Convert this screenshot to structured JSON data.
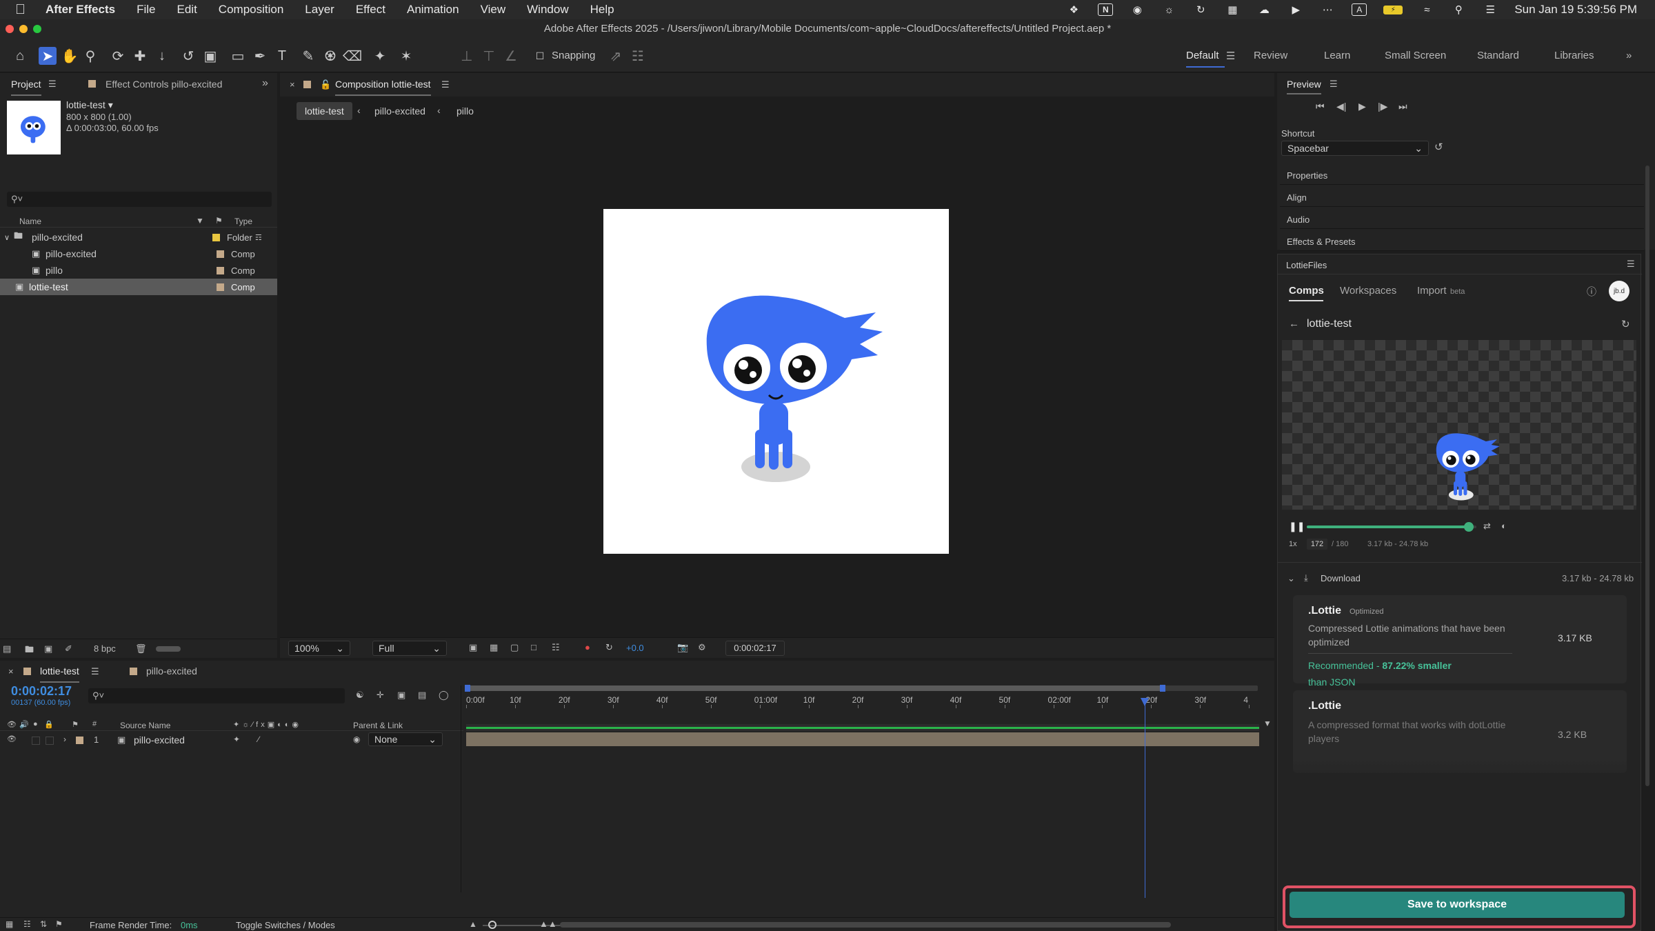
{
  "menubar": {
    "app": "After Effects",
    "items": [
      "File",
      "Edit",
      "Composition",
      "Layer",
      "Effect",
      "Animation",
      "View",
      "Window",
      "Help"
    ],
    "clock": "Sun Jan 19  5:39:56 PM"
  },
  "titlebar": {
    "title": "Adobe After Effects 2025 - /Users/jiwon/Library/Mobile Documents/com~apple~CloudDocs/aftereffects/Untitled Project.aep *"
  },
  "toolbar": {
    "snapping": "Snapping",
    "workspaces": [
      "Default",
      "Review",
      "Learn",
      "Small Screen",
      "Standard",
      "Libraries"
    ]
  },
  "project": {
    "tab": "Project",
    "tab2": "Effect Controls pillo-excited",
    "thumb_name": "lottie-test ▾",
    "thumb_size": "800 x 800 (1.00)",
    "thumb_duration": "Δ 0:00:03:00, 60.00 fps",
    "col_name": "Name",
    "col_type": "Type",
    "items": [
      {
        "name": "pillo-excited",
        "type": "Folder",
        "color": "#e8c640"
      },
      {
        "name": "pillo-excited",
        "type": "Comp",
        "color": "#c4a98a"
      },
      {
        "name": "pillo",
        "type": "Comp",
        "color": "#c4a98a"
      },
      {
        "name": "lottie-test",
        "type": "Comp",
        "color": "#c4a98a"
      }
    ],
    "bpc": "8 bpc"
  },
  "viewer": {
    "tab": "Composition lottie-test",
    "crumbs": [
      "lottie-test",
      "pillo-excited",
      "pillo"
    ],
    "zoom": "100%",
    "quality": "Full",
    "exposure": "+0.0",
    "timecode": "0:00:02:17"
  },
  "preview": {
    "title": "Preview",
    "shortcut_label": "Shortcut",
    "shortcut_value": "Spacebar",
    "panels": [
      "Properties",
      "Align",
      "Audio",
      "Effects & Presets"
    ]
  },
  "lottie": {
    "title": "LottieFiles",
    "tabs": [
      "Comps",
      "Workspaces",
      "Import"
    ],
    "beta": "beta",
    "avatar": "jb.d",
    "comp_name": "lottie-test",
    "speed": "1x",
    "frame": "172",
    "frame_total": "/ 180",
    "sizes": "3.17 kb - 24.78 kb",
    "progress": 0.955,
    "download_label": "Download",
    "download_sizes": "3.17 kb - 24.78 kb",
    "opt1_title": ".Lottie",
    "opt1_badge": "Optimized",
    "opt1_desc": "Compressed Lottie animations that have been optimized",
    "opt1_size": "3.17 KB",
    "opt1_rec": "Recommended - ",
    "opt1_rec2": "87.22% smaller",
    "opt1_rec3": "than JSON",
    "opt2_title": ".Lottie",
    "opt2_desc": "A compressed format that works with dotLottie players",
    "opt2_size": "3.2 KB",
    "save": "Save to workspace"
  },
  "timeline": {
    "tab": "lottie-test",
    "tab2": "pillo-excited",
    "timecode": "0:00:02:17",
    "frames": "00137 (60.00 fps)",
    "col_source": "Source Name",
    "col_parent": "Parent & Link",
    "layer_num": "1",
    "layer_name": "pillo-excited",
    "parent": "None",
    "ruler": [
      "0:00f",
      "10f",
      "20f",
      "30f",
      "40f",
      "50f",
      "01:00f",
      "10f",
      "20f",
      "30f",
      "40f",
      "50f",
      "02:00f",
      "10f",
      "20f",
      "30f",
      "4"
    ],
    "render_label": "Frame Render Time:",
    "render_value": "0ms",
    "toggle": "Toggle Switches / Modes"
  },
  "colors": {
    "accent": "#3f6bd4",
    "lottie_green": "#27877d",
    "highlight": "#e05265",
    "pillo_blue": "#3b6df2"
  }
}
